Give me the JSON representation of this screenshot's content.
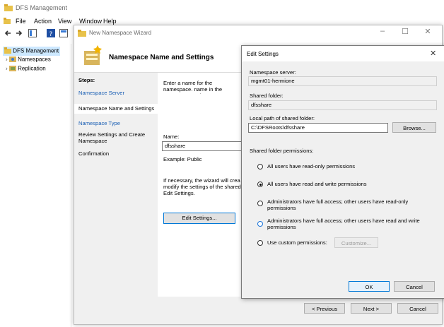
{
  "app": {
    "title": "DFS Management",
    "menu": [
      "File",
      "Action",
      "View",
      "Window",
      "Help"
    ]
  },
  "tree": {
    "root": "DFS Management",
    "items": [
      "Namespaces",
      "Replication"
    ]
  },
  "wizard": {
    "title": "New Namespace Wizard",
    "header": "Namespace Name and Settings",
    "steps_heading": "Steps:",
    "steps": [
      "Namespace Server",
      "Namespace Name and Settings",
      "Namespace Type",
      "Review Settings and Create Namespace",
      "Confirmation"
    ],
    "intro_text": "Enter a name for the namespace. name in the namespace path, su",
    "name_label": "Name:",
    "name_value": "dfsshare",
    "example": "Example: Public",
    "note_text": "If necessary, the wizard will crea modify the settings of the shared Edit Settings.",
    "edit_settings_button": "Edit Settings...",
    "prev_button": "< Previous",
    "next_button": "Next >",
    "cancel_button": "Cancel"
  },
  "dialog": {
    "title": "Edit Settings",
    "server_label": "Namespace server:",
    "server_value": "mgmt01-hermione",
    "folder_label": "Shared folder:",
    "folder_value": "dfsshare",
    "path_label": "Local path of shared folder:",
    "path_value": "C:\\DFSRoots\\dfsshare",
    "browse_button": "Browse...",
    "permissions_label": "Shared folder permissions:",
    "options": [
      "All users have read-only permissions",
      "All users have read and write permissions",
      "Administrators have full access; other users have read-only permissions",
      "Administrators have full access; other users have read and write permissions",
      "Use custom permissions:"
    ],
    "customize_button": "Customize...",
    "ok_button": "OK",
    "cancel_button": "Cancel"
  }
}
